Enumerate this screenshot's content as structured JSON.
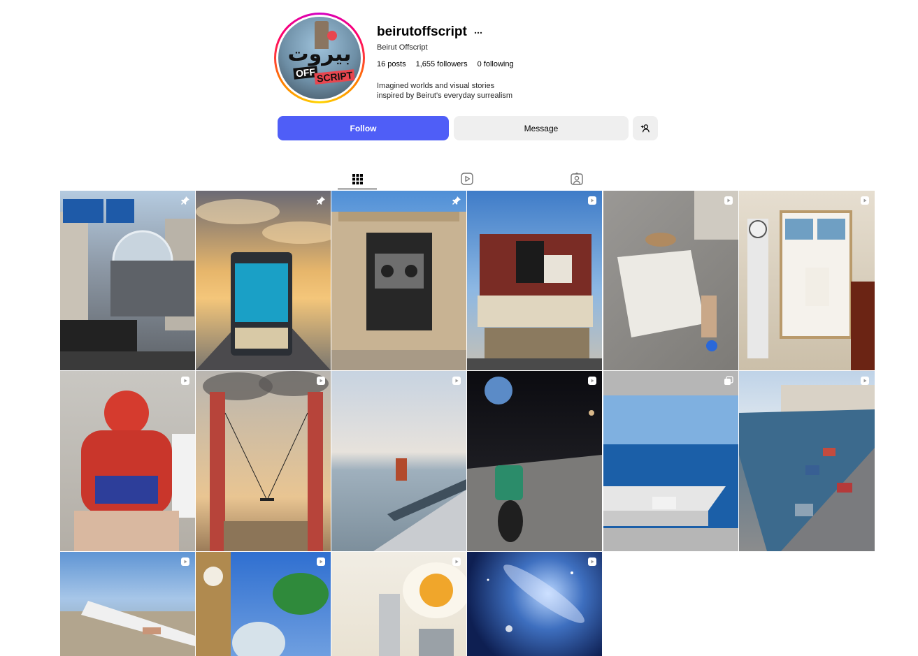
{
  "profile": {
    "username": "beirutoffscript",
    "more_icon": "more-horizontal-icon",
    "full_name": "Beirut Offscript",
    "avatar_text_arabic": "بيروت",
    "avatar_text_off": "OFF",
    "avatar_text_script": "SCRIPT",
    "stats": {
      "posts": "16 posts",
      "followers": "1,655 followers",
      "following": "0 following"
    },
    "bio_line1": "Imagined worlds and visual stories",
    "bio_line2": "inspired by Beirut's everyday surrealism"
  },
  "actions": {
    "follow_label": "Follow",
    "message_label": "Message",
    "add_user_icon": "add-user-icon"
  },
  "tabs": [
    {
      "name": "posts",
      "icon": "grid-icon",
      "active": true
    },
    {
      "name": "reels",
      "icon": "reels-icon",
      "active": false
    },
    {
      "name": "tagged",
      "icon": "tagged-icon",
      "active": false
    }
  ],
  "colors": {
    "follow_button": "#4f5ef7",
    "secondary_button": "#efefef",
    "text": "#262626"
  },
  "posts": [
    {
      "id": "p1",
      "badge": "pin"
    },
    {
      "id": "p2",
      "badge": "pin"
    },
    {
      "id": "p3",
      "badge": "pin"
    },
    {
      "id": "p4",
      "badge": "reel"
    },
    {
      "id": "p5",
      "badge": "reel"
    },
    {
      "id": "p6",
      "badge": "reel"
    },
    {
      "id": "p7",
      "badge": "reel"
    },
    {
      "id": "p8",
      "badge": "reel"
    },
    {
      "id": "p9",
      "badge": "reel"
    },
    {
      "id": "p10",
      "badge": "reel"
    },
    {
      "id": "p11",
      "badge": "carousel"
    },
    {
      "id": "p12",
      "badge": "reel"
    },
    {
      "id": "p13",
      "badge": "reel"
    },
    {
      "id": "p14",
      "badge": "reel"
    },
    {
      "id": "p15",
      "badge": "reel"
    },
    {
      "id": "p16",
      "badge": "reel"
    }
  ]
}
